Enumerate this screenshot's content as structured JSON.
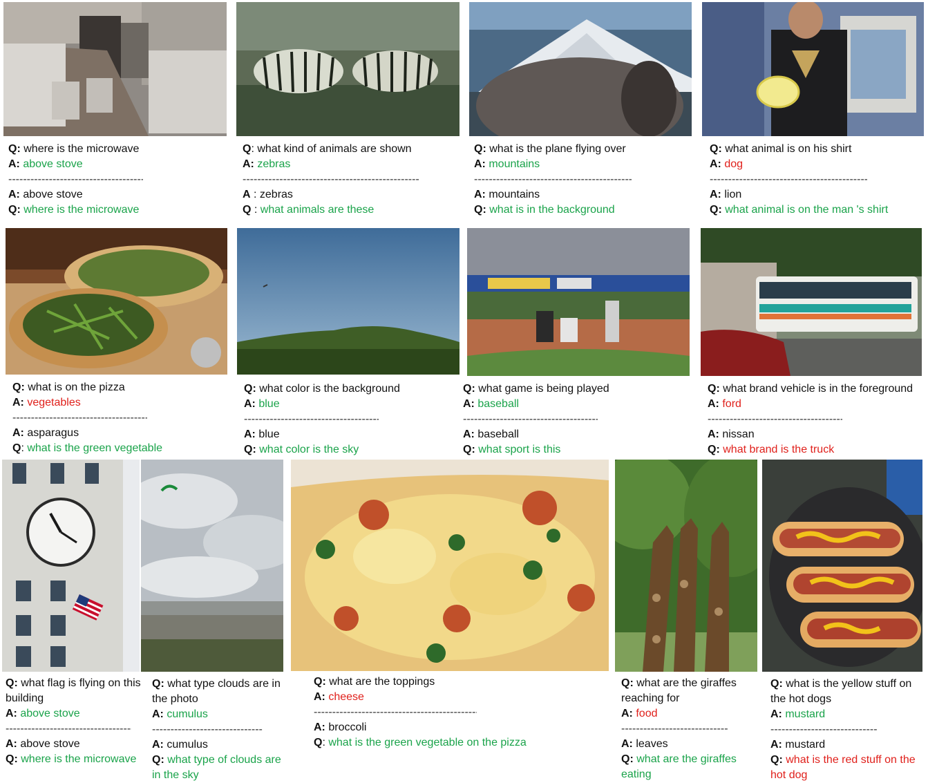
{
  "panels": [
    {
      "q1": "where is the microwave",
      "a1": "above stove",
      "a1c": "green",
      "a2": "above stove",
      "q2": "where is the microwave",
      "q2c": "green"
    },
    {
      "q1": "what kind of animals are shown",
      "a1": "zebras",
      "a1c": "green",
      "a2": "zebras",
      "q2": "what animals are these",
      "q2c": "green"
    },
    {
      "q1": "what is the plane flying over",
      "a1": "mountains",
      "a1c": "green",
      "a2": "mountains",
      "q2": "what is in the background",
      "q2c": "green"
    },
    {
      "q1": "what animal is on his shirt",
      "a1": "dog",
      "a1c": "red",
      "a2": "lion",
      "q2": "what animal is on the man 's shirt",
      "q2c": "green"
    },
    {
      "q1": "what is on the pizza",
      "a1": "vegetables",
      "a1c": "red",
      "a2": "asparagus",
      "q2": "what is the green vegetable",
      "q2c": "green"
    },
    {
      "q1": "what color is the background",
      "a1": "blue",
      "a1c": "green",
      "a2": "blue",
      "q2": "what color is the sky",
      "q2c": "green"
    },
    {
      "q1": "what game is being played",
      "a1": "baseball",
      "a1c": "green",
      "a2": "baseball",
      "q2": "what sport is this",
      "q2c": "green"
    },
    {
      "q1": "what brand vehicle is in the foreground",
      "a1": "ford",
      "a1c": "red",
      "a2": "nissan",
      "q2": "what brand is the truck",
      "q2c": "red"
    },
    {
      "q1": "what flag is flying on this building",
      "a1": "above stove",
      "a1c": "green",
      "a2": "above stove",
      "q2": "where is the microwave",
      "q2c": "green"
    },
    {
      "q1": "what type clouds are in the photo",
      "a1": "cumulus",
      "a1c": "green",
      "a2": "cumulus",
      "q2": "what type of clouds are in the sky",
      "q2c": "green"
    },
    {
      "q1": "what are the toppings",
      "a1": "cheese",
      "a1c": "red",
      "a2": "broccoli",
      "q2": "what is the green vegetable on the pizza",
      "q2c": "green"
    },
    {
      "q1": "what are the giraffes reaching for",
      "a1": "food",
      "a1c": "red",
      "a2": "leaves",
      "q2": "what are the giraffes eating",
      "q2c": "green"
    },
    {
      "q1": "what is the yellow stuff on the hot dogs",
      "a1": "mustard",
      "a1c": "green",
      "a2": "mustard",
      "q2": "what is the red stuff on the hot dog",
      "q2c": "red"
    }
  ],
  "labels": {
    "q": "Q:",
    "a": "A:",
    "q_spaced": "Q",
    "a_spaced": "A"
  },
  "colors": {
    "correct": "#1aa34a",
    "wrong": "#e0201b"
  }
}
